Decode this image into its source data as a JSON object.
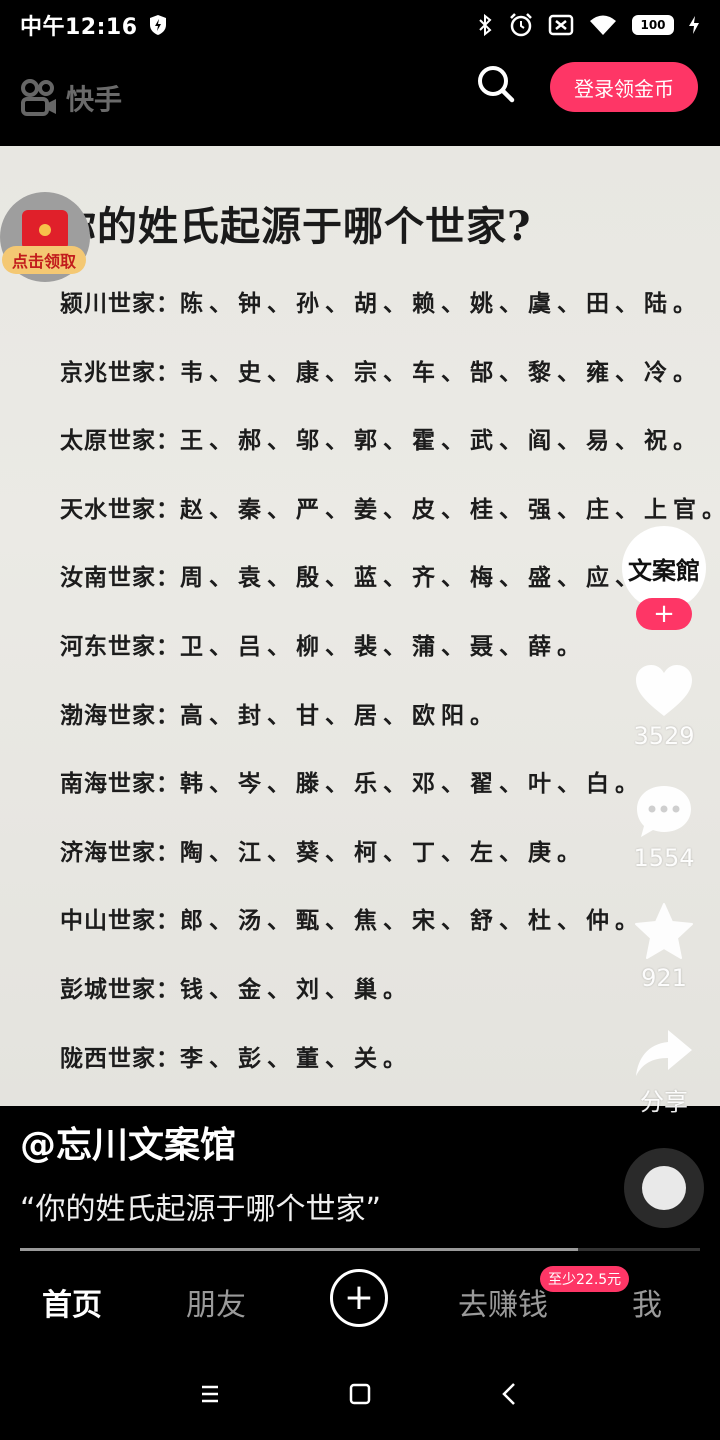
{
  "status_bar": {
    "time": "中午12:16",
    "battery": "100"
  },
  "header": {
    "logo_text": "快手",
    "login_button": "登录领金币"
  },
  "video": {
    "title": "你的姓氏起源于哪个世家?",
    "clans": [
      {
        "name": "颍川世家：",
        "surnames": "陈、钟、孙、胡、赖、姚、虞、田、陆。"
      },
      {
        "name": "京兆世家：",
        "surnames": "韦、史、康、宗、车、郜、黎、雍、冷。"
      },
      {
        "name": "太原世家：",
        "surnames": "王、郝、邬、郭、霍、武、阎、易、祝。"
      },
      {
        "name": "天水世家：",
        "surnames": "赵、秦、严、姜、皮、桂、强、庄、上官。"
      },
      {
        "name": "汝南世家：",
        "surnames": "周、袁、殷、蓝、齐、梅、盛、应、"
      },
      {
        "name": "河东世家：",
        "surnames": "卫、吕、柳、裴、蒲、聂、薛。"
      },
      {
        "name": "渤海世家：",
        "surnames": "高、封、甘、居、欧阳。"
      },
      {
        "name": "南海世家：",
        "surnames": "韩、岑、滕、乐、邓、翟、叶、白。"
      },
      {
        "name": "济海世家：",
        "surnames": "陶、江、葵、柯、丁、左、庚。"
      },
      {
        "name": "中山世家：",
        "surnames": "郎、汤、甄、焦、宋、舒、杜、仲。"
      },
      {
        "name": "彭城世家：",
        "surnames": "钱、金、刘、巢。"
      },
      {
        "name": "陇西世家：",
        "surnames": "李、彭、董、关。"
      }
    ]
  },
  "rail": {
    "redpacket_label": "点击领取",
    "avatar_text": "文案館",
    "follow_symbol": "+",
    "likes": "3529",
    "comments": "1554",
    "favorites": "921",
    "share_label": "分享"
  },
  "post": {
    "author": "@忘川文案馆",
    "caption": "“你的姓氏起源于哪个世家”",
    "progress": 0.82
  },
  "bottom_nav": {
    "home": "首页",
    "friends": "朋友",
    "plus": "+",
    "earn": "去赚钱",
    "earn_badge": "至少22.5元",
    "me": "我"
  },
  "colors": {
    "accent": "#fe3666",
    "paper": "#e8e7e2",
    "redpacket_red": "#e0202a",
    "redpacket_label_bg": "#f4c873"
  }
}
